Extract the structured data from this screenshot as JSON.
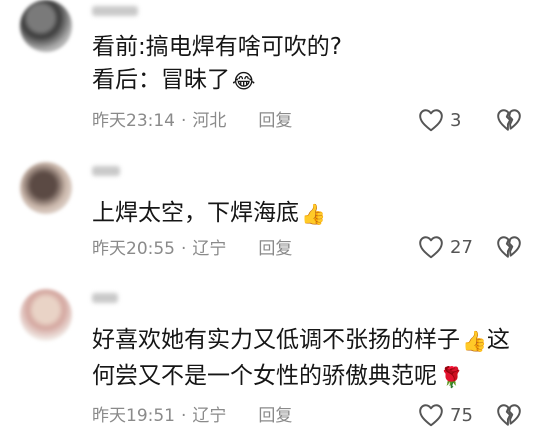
{
  "comments": [
    {
      "username": "",
      "lines": [
        "看前:搞电焊有啥可吹的?",
        "看后：冒昧了"
      ],
      "emoji": "😂",
      "time": "昨天23:14",
      "location": "河北",
      "reply_label": "回复",
      "likes": "3"
    },
    {
      "username": "",
      "lines": [
        "上焊太空，下焊海底"
      ],
      "emoji": "👍",
      "time": "昨天20:55",
      "location": "辽宁",
      "reply_label": "回复",
      "likes": "27"
    },
    {
      "username": "",
      "lines": [
        "好喜欢她有实力又低调不张扬的样子",
        "这",
        "何尝又不是一个女性的骄傲典范呢"
      ],
      "emoji": "👍",
      "emoji2": "🌹",
      "time": "昨天19:51",
      "location": "辽宁",
      "reply_label": "回复",
      "likes": "75"
    }
  ],
  "colors": {
    "text": "#161616",
    "meta": "#8a8a8a",
    "background": "#ffffff"
  },
  "icons": {
    "like": "heart-outline-icon",
    "dislike": "broken-heart-icon"
  }
}
